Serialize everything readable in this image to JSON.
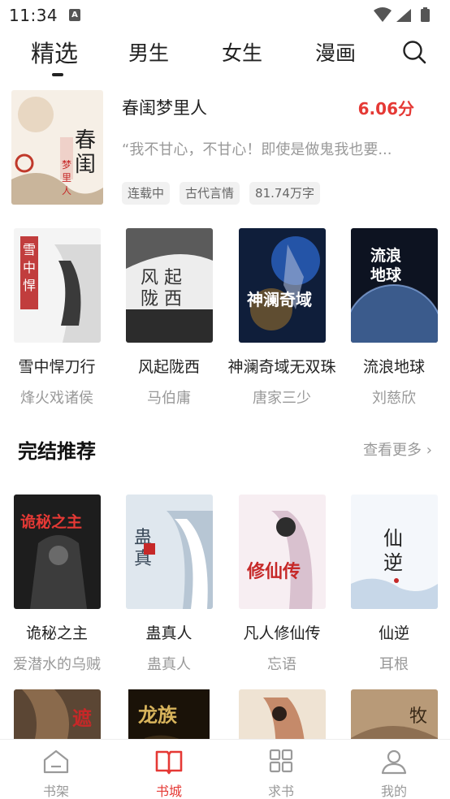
{
  "status_bar": {
    "time": "11:34",
    "notification_letter": "A"
  },
  "tabs": [
    {
      "label": "精选",
      "active": true
    },
    {
      "label": "男生",
      "active": false
    },
    {
      "label": "女生",
      "active": false
    },
    {
      "label": "漫画",
      "active": false
    }
  ],
  "featured": {
    "title": "春闺梦里人",
    "score": "6.06分",
    "description": "“我不甘心，不甘心！即使是做鬼我也要...",
    "tags": [
      "连载中",
      "古代言情",
      "81.74万字"
    ],
    "cover_text": "春闺梦里人"
  },
  "row1": [
    {
      "name": "雪中悍刀行",
      "author": "烽火戏诸侯",
      "cover_text": "雪中悍刀行"
    },
    {
      "name": "风起陇西",
      "author": "马伯庸",
      "cover_text": "风起陇西"
    },
    {
      "name": "神澜奇域无双珠",
      "author": "唐家三少",
      "cover_text": "神澜奇域"
    },
    {
      "name": "流浪地球",
      "author": "刘慈欣",
      "cover_text": "流浪地球"
    }
  ],
  "section": {
    "title": "完结推荐",
    "more": "查看更多"
  },
  "row2": [
    {
      "name": "诡秘之主",
      "author": "爱潜水的乌贼",
      "cover_text": "诡秘之主"
    },
    {
      "name": "蛊真人",
      "author": "蛊真人",
      "cover_text": "蛊真人"
    },
    {
      "name": "凡人修仙传",
      "author": "忘语",
      "cover_text": "修仙传"
    },
    {
      "name": "仙逆",
      "author": "耳根",
      "cover_text": "仙逆"
    }
  ],
  "row3": [
    {
      "cover_text": "遮"
    },
    {
      "cover_text": "龙族"
    },
    {
      "cover_text": ""
    },
    {
      "cover_text": "牧"
    }
  ],
  "bottom_nav": [
    {
      "label": "书架",
      "active": false
    },
    {
      "label": "书城",
      "active": true
    },
    {
      "label": "求书",
      "active": false
    },
    {
      "label": "我的",
      "active": false
    }
  ],
  "colors": {
    "accent": "#e53935",
    "muted": "#999999"
  }
}
